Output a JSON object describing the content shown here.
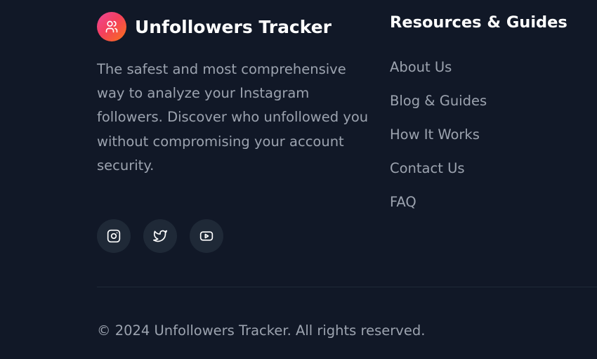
{
  "brand": {
    "name": "Unfollowers Tracker",
    "logo_icon": "users-icon",
    "logo_gradient": [
      "#ec4899",
      "#f97316"
    ]
  },
  "about": {
    "description": "The safest and most comprehensive way to analyze your Instagram followers. Discover who unfollowed you without compromising your account security."
  },
  "socials": [
    {
      "icon": "instagram-icon"
    },
    {
      "icon": "twitter-icon"
    },
    {
      "icon": "youtube-icon"
    }
  ],
  "resources": {
    "title": "Resources & Guides",
    "links": [
      {
        "label": "About Us"
      },
      {
        "label": "Blog & Guides"
      },
      {
        "label": "How It Works"
      },
      {
        "label": "Contact Us"
      },
      {
        "label": "FAQ"
      }
    ]
  },
  "footer": {
    "copyright": "© 2024 Unfollowers Tracker. All rights reserved."
  },
  "colors": {
    "background": "#111827",
    "text_muted": "#9ca3af",
    "heading": "#ffffff",
    "social_bg": "#1f2937"
  }
}
